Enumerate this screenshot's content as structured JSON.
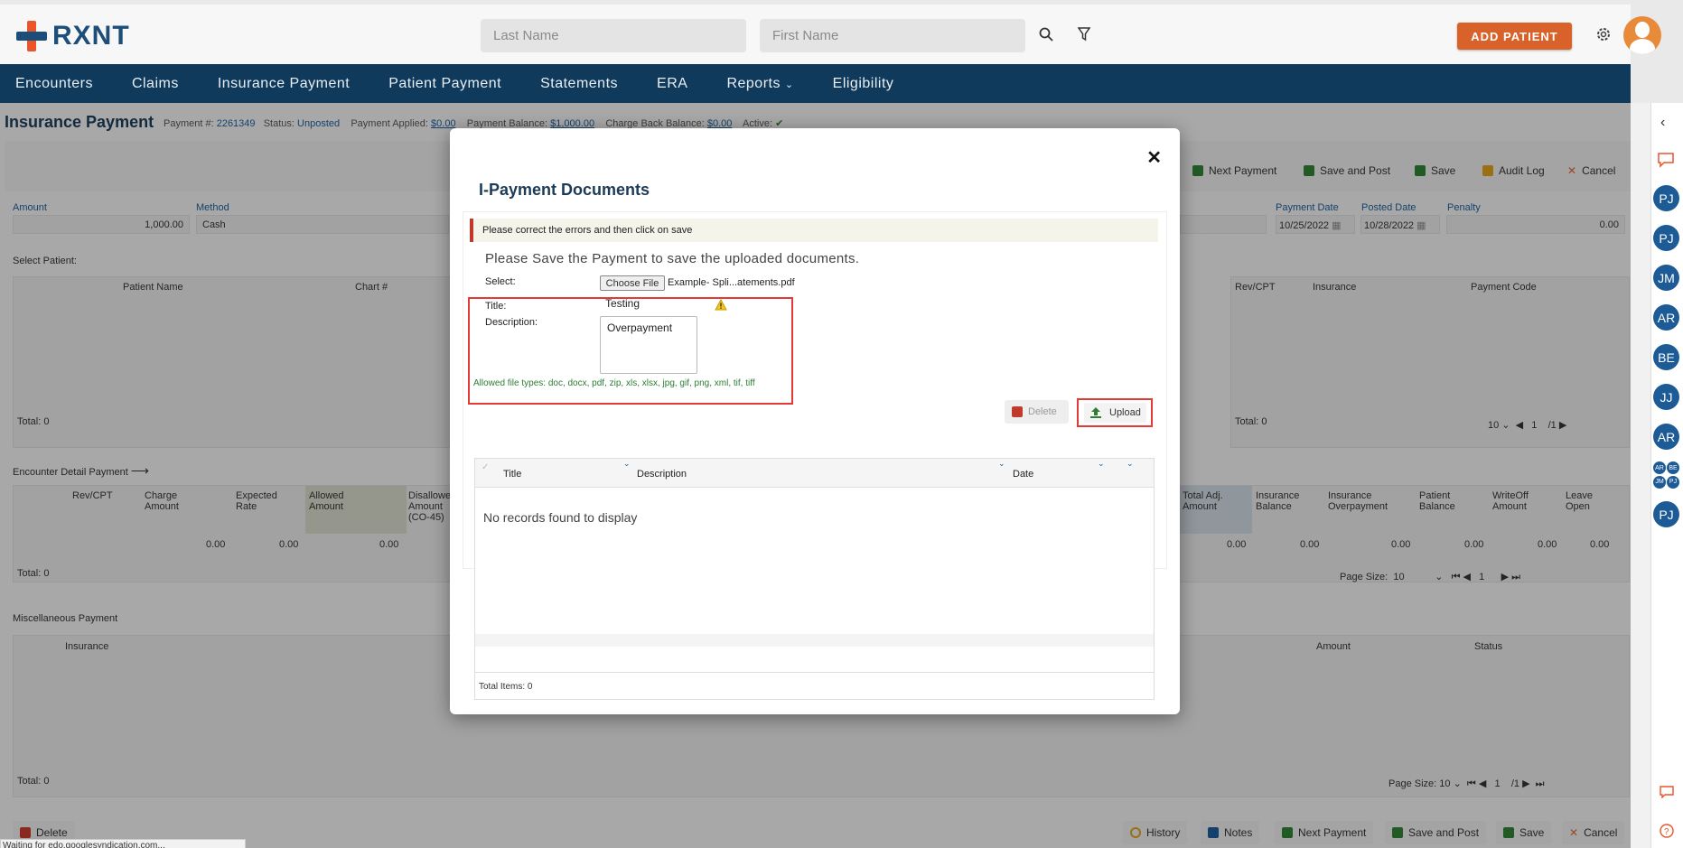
{
  "header": {
    "logo": "RXNT",
    "last_name_placeholder": "Last Name",
    "first_name_placeholder": "First Name",
    "add_patient": "ADD PATIENT"
  },
  "nav": {
    "items": [
      "Encounters",
      "Claims",
      "Insurance Payment",
      "Patient Payment",
      "Statements",
      "ERA",
      "Reports",
      "Eligibility"
    ]
  },
  "page": {
    "title": "Insurance Payment",
    "payment_no_label": "Payment #:",
    "payment_no": "2261349",
    "status_label": "Status:",
    "status": "Unposted",
    "applied_label": "Payment Applied:",
    "applied": "$0.00",
    "balance_label": "Payment Balance:",
    "balance": "$1,000.00",
    "chargeback_label": "Charge Back Balance:",
    "chargeback": "$0.00",
    "active_label": "Active:",
    "toolbar": [
      "Next Payment",
      "Save and Post",
      "Save",
      "Audit Log",
      "Cancel"
    ],
    "amount_label": "Amount",
    "amount": "1,000.00",
    "method_label": "Method",
    "method": "Cash",
    "payment_date_label": "Payment Date",
    "payment_date": "10/25/2022",
    "posted_date_label": "Posted Date",
    "posted_date": "10/28/2022",
    "penalty_label": "Penalty",
    "penalty": "0.00",
    "select_patient": "Select Patient:",
    "patient_name_col": "Patient Name",
    "chart_col": "Chart #",
    "revcpt_col": "Rev/CPT",
    "insurance_col": "Insurance",
    "payment_code_col": "Payment Code",
    "total0": "Total: 0",
    "encounter_detail": "Encounter Detail Payment",
    "enc_cols": [
      "Rev/CPT",
      "Charge Amount",
      "Expected Rate",
      "Allowed Amount",
      "Disallowed Amount (CO-45)"
    ],
    "enc_cols_right": [
      "Total Adj. Amount",
      "Insurance Balance",
      "Insurance Overpayment",
      "Patient Balance",
      "WriteOff Amount",
      "Leave Open"
    ],
    "zero": "0.00",
    "page_size_label": "Page Size:",
    "page_size": "10",
    "page_num": "1",
    "page_of": "/1",
    "misc_payment": "Miscellaneous Payment",
    "misc_insurance": "Insurance",
    "misc_amount": "Amount",
    "misc_status": "Status",
    "footer_buttons": [
      "History",
      "Notes",
      "Next Payment",
      "Save and Post",
      "Save",
      "Cancel"
    ],
    "delete": "Delete",
    "status_bar": "Waiting for edo.googlesyndication.com..."
  },
  "sidebar_avatars": [
    "PJ",
    "PJ",
    "JM",
    "AR",
    "BE",
    "JJ",
    "AR",
    "PJ"
  ],
  "sidebar_group": [
    "AR",
    "BE",
    "JM",
    "PJ"
  ],
  "modal": {
    "title": "I-Payment Documents",
    "error": "Please correct the errors and then click on save",
    "save_note": "Please Save the Payment to save the uploaded documents.",
    "select_label": "Select:",
    "choose_file": "Choose File",
    "file_name": "Example- Spli...atements.pdf",
    "title_label": "Title:",
    "title_value": "Testing",
    "description_label": "Description:",
    "description_value": "Overpayment",
    "allowed_types": "Allowed file types: doc, docx, pdf, zip, xls, xlsx, jpg, gif, png, xml, tif, tiff",
    "delete": "Delete",
    "upload": "Upload",
    "grid_cols": [
      "Title",
      "Description",
      "Date"
    ],
    "no_records": "No records found to display",
    "total_items": "Total Items: 0"
  }
}
